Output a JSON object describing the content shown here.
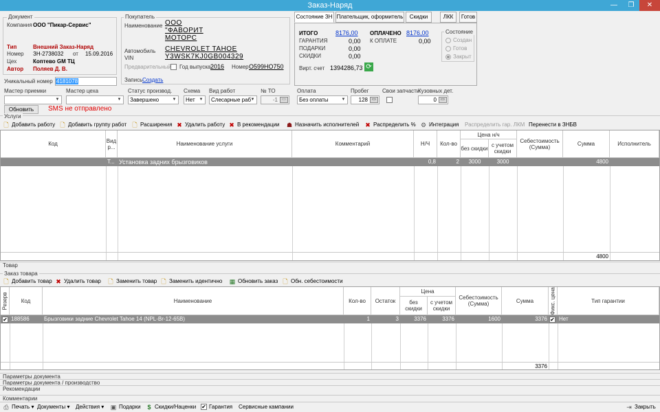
{
  "window": {
    "title": "Заказ-Наряд"
  },
  "document": {
    "group_label": "Документ",
    "company_label": "Компания",
    "company_value": "ООО \"Пикар-Сервис\"",
    "type_label": "Тип",
    "type_value": "Внешний Заказ-Наряд",
    "number_label": "Номер",
    "number_value": "ЗН-2738032",
    "from_label": "от",
    "date_value": "15.09.2016",
    "shop_label": "Цех",
    "shop_value": "Коптево GM ТЦ",
    "author_label": "Автор",
    "author_value": "Поляев Д. В.",
    "unique_label": "Уникальный номер",
    "unique_value": "4181078"
  },
  "buyer": {
    "group_label": "Покупатель",
    "name_label": "Наименование",
    "name_lines": [
      "ООО",
      "\"ФАВОРИТ",
      "МОТОРС"
    ],
    "car_label": "Автомобиль",
    "car_value": "CHEVROLET TAHOE",
    "vin_label": "VIN",
    "vin_value": "Y3WSK7KJ0GB004329",
    "prelim_label": "Предварительный",
    "year_label": "Год выпуска",
    "year_value": "2016",
    "plate_label": "Номер",
    "plate_value": "О599НО750",
    "record_label": "Запись",
    "record_link": "Создать"
  },
  "right_tabs": [
    "Состояние ЗН",
    "Плательщик, оформитель",
    "Скидки",
    "ЛКК",
    "Готов"
  ],
  "totals": {
    "itogo_label": "ИТОГО",
    "itogo_value": "8176,00",
    "paid_label": "ОПЛАЧЕНО",
    "paid_value": "8176,00",
    "warranty_label": "ГАРАНТИЯ",
    "warranty_value": "0,00",
    "to_pay_label": "К ОПЛАТЕ",
    "to_pay_value": "0,00",
    "gifts_label": "ПОДАРКИ",
    "gifts_value": "0,00",
    "discounts_label": "СКИДКИ",
    "discounts_value": "0,00",
    "virt_label": "Вирт. счет",
    "virt_value": "1394286,73"
  },
  "state": {
    "group_label": "Состояние",
    "options": [
      "Создан",
      "Готов",
      "Закрыт"
    ],
    "selected": "Закрыт"
  },
  "fields": {
    "master_reception_label": "Мастер приемки",
    "master_shop_label": "Мастер цеха",
    "status_label": "Статус производ.",
    "status_value": "Завершено",
    "scheme_label": "Схема",
    "scheme_value": "Нет",
    "work_type_label": "Вид работ",
    "work_type_value": "Слесарные раб",
    "to_label": "№ ТО",
    "to_value": "-1",
    "payment_label": "Оплата",
    "payment_value": "Без оплаты",
    "mileage_label": "Пробег",
    "mileage_value": "128",
    "own_parts_label": "Свои запчасти",
    "body_label": "Кузовных дет.",
    "body_value": "0",
    "refresh_button": "Обновить",
    "sms_status": "SMS не отправлено"
  },
  "services": {
    "group_label": "Услуги",
    "toolbar": [
      "Добавить работу",
      "Добавить группу работ",
      "Расширения",
      "Удалить работу",
      "В рекомендации",
      "Назначить исполнителей",
      "Распределить %",
      "Интеграция",
      "Распределить гар. ЛКМ",
      "Перенести в ЗНБВ"
    ],
    "headers": {
      "code": "Код",
      "type": "Вид р...",
      "name": "Наименование услуги",
      "comment": "Комментарий",
      "nh": "Н/Ч",
      "qty": "Кол-во",
      "price_group": "Цена н/ч",
      "no_disc": "без скидки",
      "with_disc": "с учетом скидки",
      "cost": "Себестоимость (Сумма)",
      "sum": "Сумма",
      "executor": "Исполнитель"
    },
    "rows": [
      {
        "code": "",
        "type": "Т...",
        "name": "Установка задних брызговиков",
        "comment": "",
        "nh": "0,8",
        "qty": "2",
        "no_disc": "3000",
        "with_disc": "3000",
        "cost": "",
        "sum": "4800",
        "executor": ""
      }
    ],
    "footer_sum": "4800"
  },
  "goods_section": "Товар",
  "goods_order": {
    "group_label": "Заказ товара",
    "toolbar": [
      "Добавить товар",
      "Удалить товар",
      "Заменить товар",
      "Заменить идентично",
      "Обновить заказ",
      "Обн. себестоимости"
    ],
    "headers": {
      "reserve": "Резерв",
      "code": "Код",
      "name": "Наименование",
      "qty": "Кол-во",
      "stock": "Остаток",
      "price_group": "Цена",
      "no_disc": "без скидки",
      "with_disc": "с учетом скидки",
      "cost": "Себестоимость (Сумма)",
      "sum": "Сумма",
      "fix_price": "Фикс. цена",
      "warranty_type": "Тип гарантии"
    },
    "rows": [
      {
        "code": "188586",
        "name": "Брызговики задние Chevrolet Tahoe 14 (NPL-Br-12-65B)",
        "qty": "1",
        "stock": "3",
        "no_disc": "3376",
        "with_disc": "3376",
        "cost": "1600",
        "sum": "3376",
        "warranty_type": "Нет"
      }
    ],
    "footer_sum": "3376"
  },
  "sections": [
    "Параметры документа",
    "Параметры документа / производство",
    "Рекомендации",
    "Комментарии"
  ],
  "bottom_bar": [
    "Печать",
    "Документы",
    "Действия",
    "Подарки",
    "Скидки/Наценки",
    "Гарантия",
    "Сервисные кампании"
  ],
  "close_button": "Закрыть"
}
